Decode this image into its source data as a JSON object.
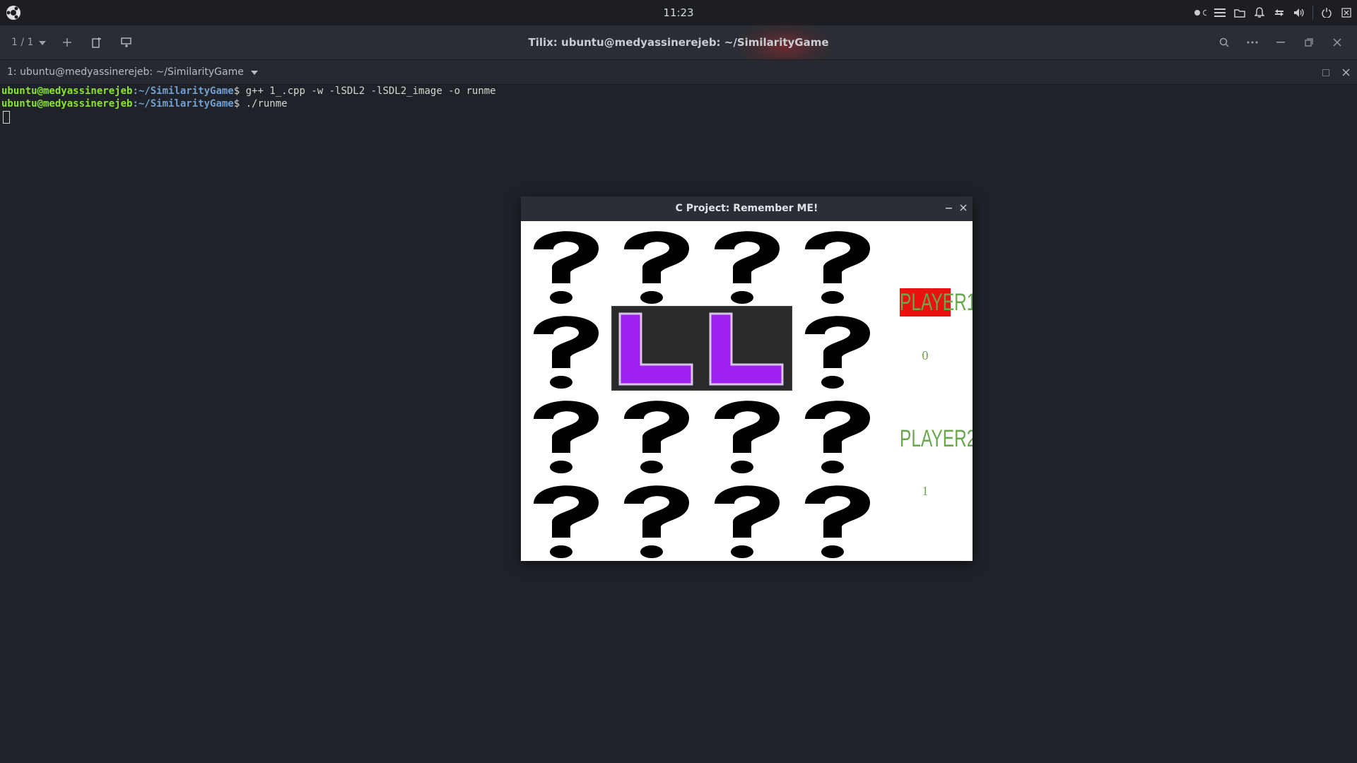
{
  "system_bar": {
    "clock": "11:23",
    "logo_icon": "ubuntu-logo-icon",
    "tray_icons": [
      "toggle-dots-icon",
      "menu-lines-icon",
      "folder-icon",
      "bell-icon",
      "network-icon",
      "volume-icon",
      "power-icon",
      "session-icon"
    ]
  },
  "tilix": {
    "window_title": "Tilix: ubuntu@medyassinerejeb: ~/SimilarityGame",
    "session_counter": "1 / 1",
    "tab_title": "1: ubuntu@medyassinerejeb: ~/SimilarityGame"
  },
  "terminal": {
    "lines": [
      {
        "user": "ubuntu@medyassinerejeb",
        "path": ":~/SimilarityGame",
        "prompt": "$ ",
        "cmd": "g++ 1_.cpp -w -lSDL2 -lSDL2_image -o runme"
      },
      {
        "user": "ubuntu@medyassinerejeb",
        "path": ":~/SimilarityGame",
        "prompt": "$ ",
        "cmd": "./runme"
      }
    ]
  },
  "game": {
    "window_title": "C Project: Remember ME!",
    "revealed_letter": "L",
    "player1_label": "PLAYER1",
    "player1_score": "0",
    "player2_label": "PLAYER2",
    "player2_score": "1",
    "active_player": "PLAYER1",
    "colors": {
      "active_bg": "#e8130f",
      "label": "#6aa84f",
      "card_letter": "#a020f0"
    }
  }
}
